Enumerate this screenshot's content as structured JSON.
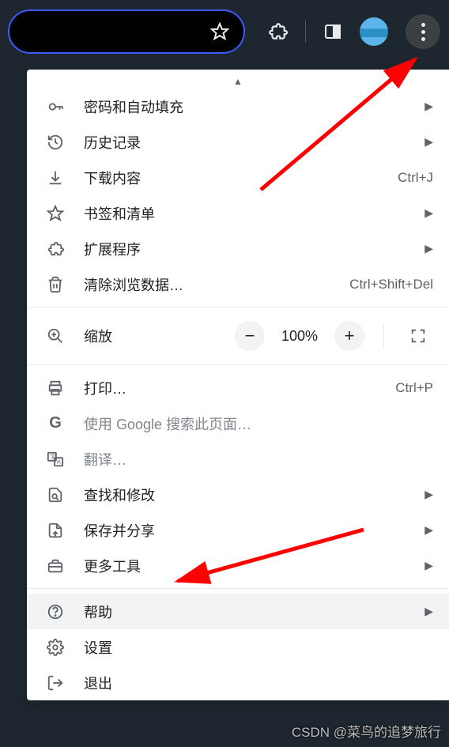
{
  "menu": {
    "passwords": "密码和自动填充",
    "history": "历史记录",
    "downloads": "下载内容",
    "downloads_shortcut": "Ctrl+J",
    "bookmarks": "书签和清单",
    "extensions": "扩展程序",
    "clear_data": "清除浏览数据…",
    "clear_data_shortcut": "Ctrl+Shift+Del",
    "zoom_label": "缩放",
    "zoom_value": "100%",
    "print": "打印…",
    "print_shortcut": "Ctrl+P",
    "search_page": "使用 Google 搜索此页面…",
    "translate": "翻译…",
    "find_edit": "查找和修改",
    "save_share": "保存并分享",
    "more_tools": "更多工具",
    "help": "帮助",
    "settings": "设置",
    "exit": "退出"
  },
  "watermark": "CSDN @菜鸟的追梦旅行"
}
